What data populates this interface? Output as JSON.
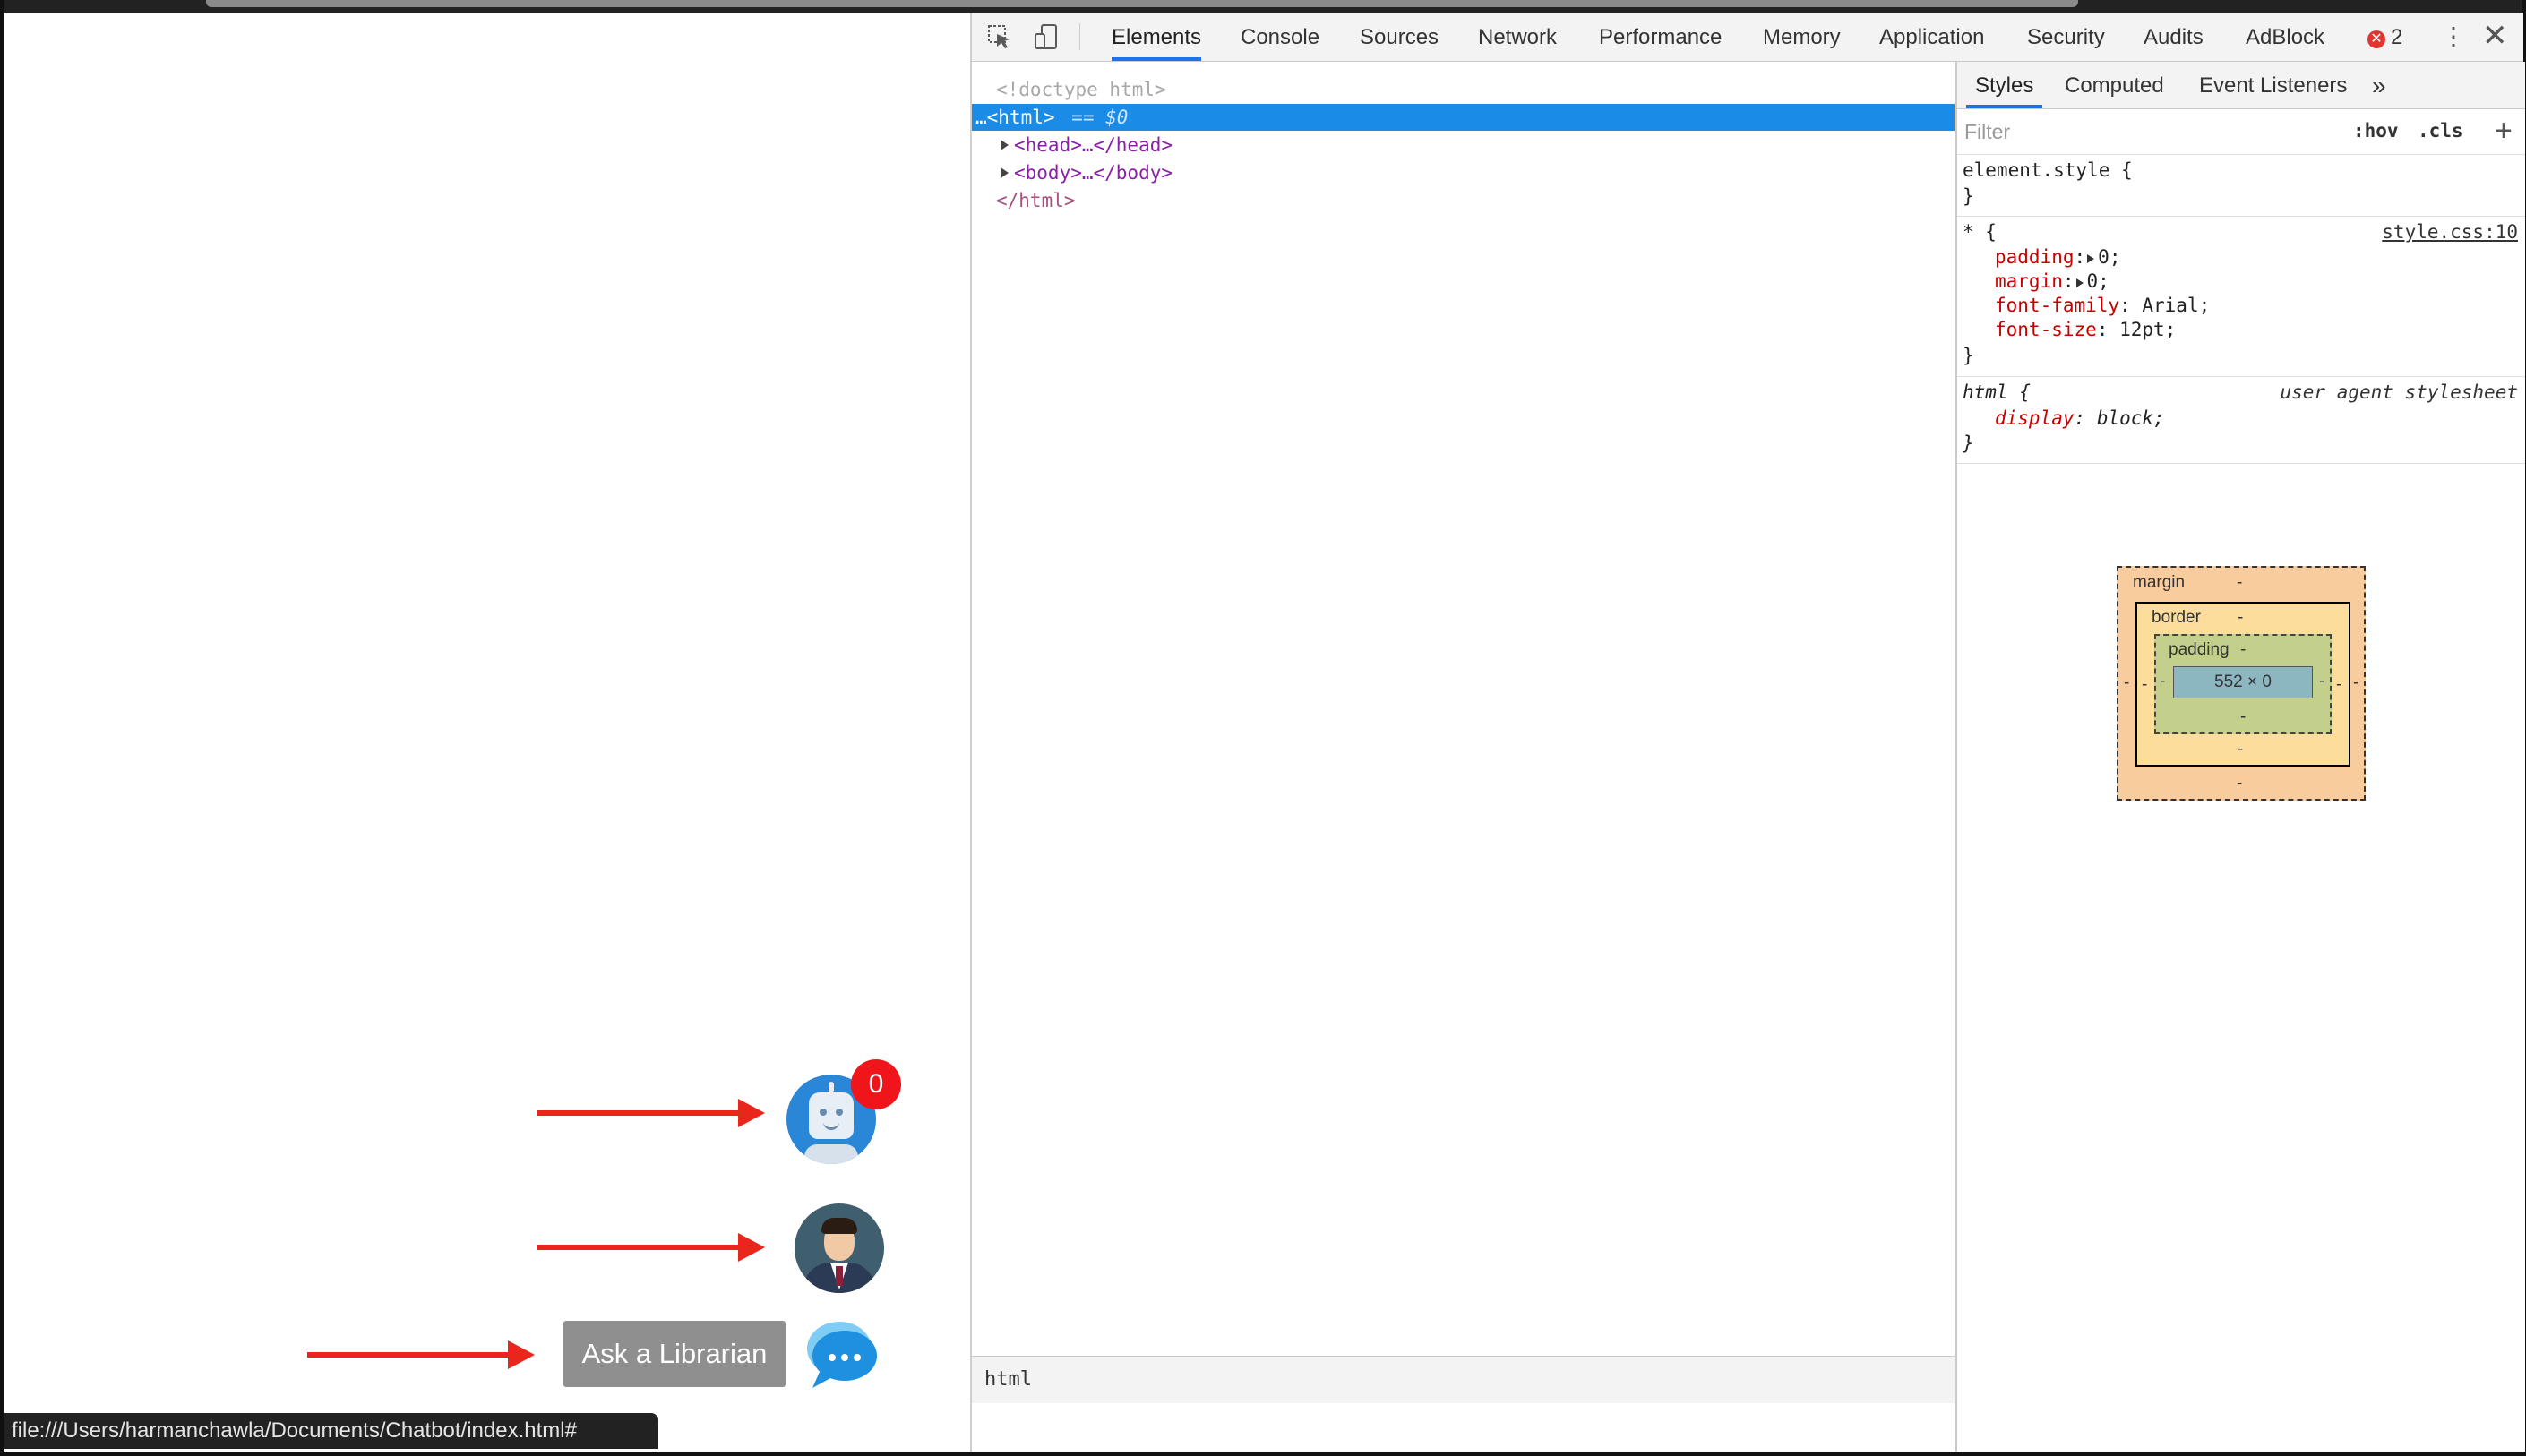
{
  "page": {
    "badge_count": "0",
    "ask_button_label": "Ask a Librarian",
    "status_url": "file:///Users/harmanchawla/Documents/Chatbot/index.html#"
  },
  "devtools": {
    "tabs": [
      "Elements",
      "Console",
      "Sources",
      "Network",
      "Performance",
      "Memory",
      "Application",
      "Security",
      "Audits",
      "AdBlock"
    ],
    "active_tab": "Elements",
    "error_count": "2",
    "dom": {
      "doctype": "<!doctype html>",
      "html_open": "<html>",
      "selected_marker": "== $0",
      "head": "<head>…</head>",
      "body": "<body>…</body>",
      "html_close": "</html>"
    },
    "breadcrumb": "html",
    "styles": {
      "tabs": [
        "Styles",
        "Computed",
        "Event Listeners"
      ],
      "more_tabs_icon": "»",
      "filter_placeholder": "Filter",
      "hov_label": ":hov",
      "cls_label": ".cls",
      "add_rule": "+",
      "element_style_selector": "element.style {",
      "close_brace": "}",
      "universal_selector": "* {",
      "universal_source": "style.css:10",
      "universal_props": [
        {
          "name": "padding",
          "value": "0;",
          "expandable": true
        },
        {
          "name": "margin",
          "value": "0;",
          "expandable": true
        },
        {
          "name": "font-family",
          "value": "Arial;",
          "expandable": false
        },
        {
          "name": "font-size",
          "value": "12pt;",
          "expandable": false
        }
      ],
      "html_selector": "html {",
      "html_source": "user agent stylesheet",
      "html_props": [
        {
          "name": "display",
          "value": "block;"
        }
      ]
    },
    "box_model": {
      "margin_label": "margin",
      "border_label": "border",
      "padding_label": "padding",
      "content_size": "552 × 0",
      "dash": "-"
    }
  },
  "colors": {
    "accent": "#1a73e8",
    "selection": "#1a8be6",
    "arrow": "#e8261c",
    "badge": "#f0141b"
  }
}
